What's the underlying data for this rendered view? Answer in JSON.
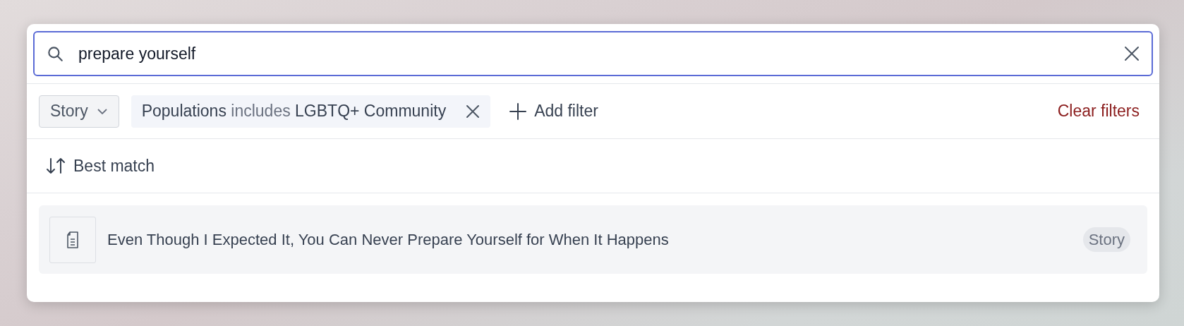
{
  "search": {
    "value": "prepare yourself"
  },
  "filters": [
    {
      "kind": "dropdown",
      "label": "Story"
    },
    {
      "kind": "chip",
      "field": "Populations",
      "operator": "includes",
      "value": "LGBTQ+ Community"
    }
  ],
  "add_filter": "Add filter",
  "clear_filters": "Clear filters",
  "sort": "Best match",
  "results": [
    {
      "title": "Even Though I Expected It, You Can Never Prepare Yourself for When It Happens",
      "tag": "Story"
    }
  ]
}
